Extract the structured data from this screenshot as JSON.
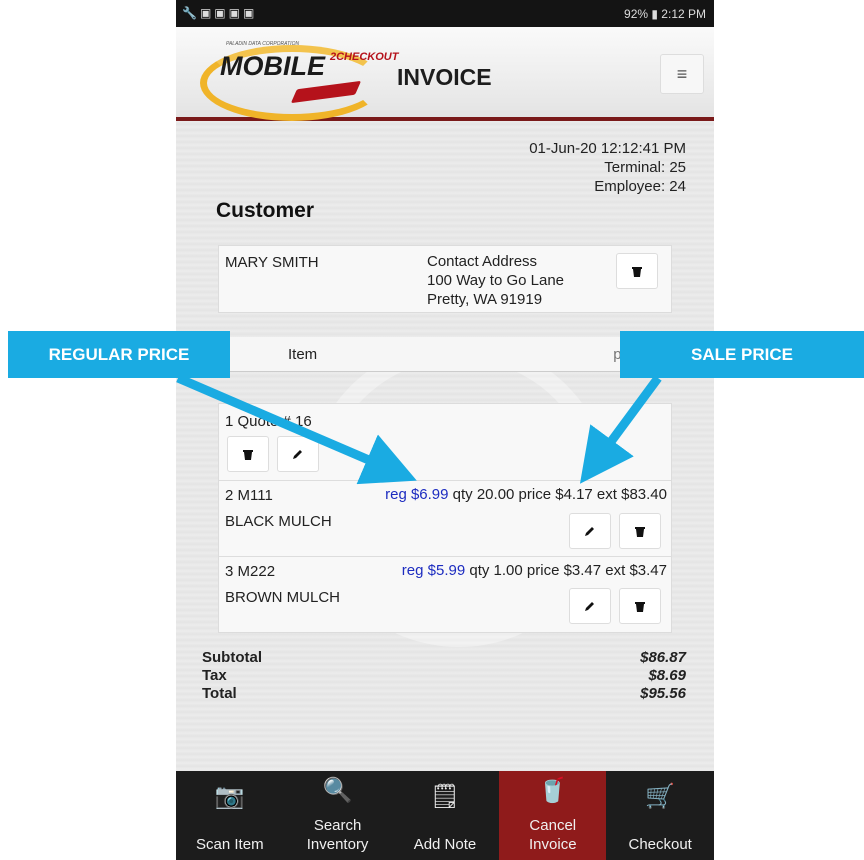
{
  "status_bar": {
    "left_icons": "🔧▣▣▣▣",
    "right": "92% ▮ 2:12 PM"
  },
  "header": {
    "logo_small": "PALADIN DATA CORPORATION",
    "logo_main": "MOBILE",
    "logo_sup": "2CHECKOUT",
    "title": "INVOICE",
    "menu_icon": "≡"
  },
  "meta": {
    "datetime": "01-Jun-20 12:12:41 PM",
    "terminal": "Terminal: 25",
    "employee": "Employee: 24"
  },
  "customer": {
    "section_title": "Customer",
    "name": "MARY SMITH",
    "address_label": "Contact Address",
    "address_line1": "100 Way to Go Lane",
    "address_line2": "Pretty, WA  91919"
  },
  "search": {
    "label": "Item",
    "placeholder": "part nu"
  },
  "quote": {
    "title": "1 Quote # 16"
  },
  "lines": [
    {
      "id": "2 M111",
      "desc": "BLACK MULCH",
      "reg": "reg $6.99",
      "rest": " qty 20.00 price $4.17 ext $83.40"
    },
    {
      "id": "3 M222",
      "desc": "BROWN MULCH",
      "reg": "reg $5.99",
      "rest": " qty 1.00 price $3.47 ext $3.47"
    }
  ],
  "totals": {
    "subtotal_label": "Subtotal",
    "subtotal": "$86.87",
    "tax_label": "Tax",
    "tax": "$8.69",
    "total_label": "Total",
    "total": "$95.56"
  },
  "nav": [
    {
      "icon": "📷",
      "label": "Scan Item"
    },
    {
      "icon": "🔍",
      "label": "Search Inventory"
    },
    {
      "icon": "🗒",
      "label": "Add Note"
    },
    {
      "icon": "🥤",
      "label": "Cancel Invoice"
    },
    {
      "icon": "🛒",
      "label": "Checkout"
    }
  ],
  "callouts": {
    "regular": "REGULAR PRICE",
    "sale": "SALE PRICE"
  },
  "colors": {
    "accent": "#8f1b1b",
    "callout": "#1aabe2",
    "reg_price": "#1d2cc0"
  },
  "icons": {
    "delete": "trash-icon",
    "edit": "pencil-icon"
  }
}
